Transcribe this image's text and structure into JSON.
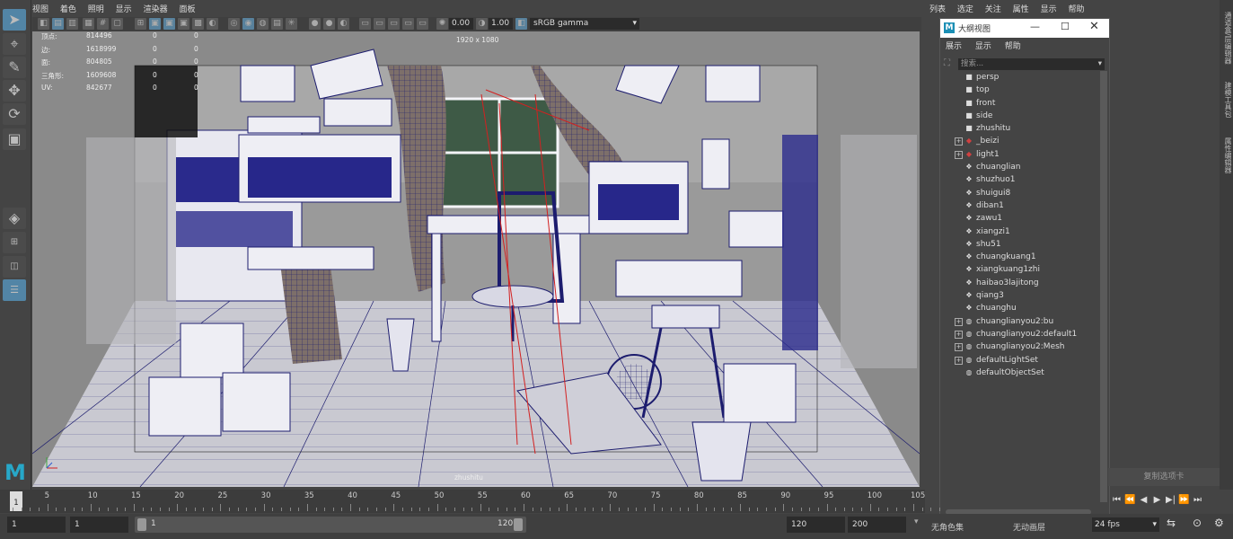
{
  "viewport_menu": [
    "视图",
    "着色",
    "照明",
    "显示",
    "渲染器",
    "面板"
  ],
  "viewport_toolbar": {
    "exposure": "0.00",
    "gamma_value": "1.00",
    "color_space": "sRGB gamma"
  },
  "hud": {
    "rows": [
      {
        "label": "顶点:",
        "a": "814496",
        "b": "0",
        "c": "0"
      },
      {
        "label": "边:",
        "a": "1618999",
        "b": "0",
        "c": "0"
      },
      {
        "label": "面:",
        "a": "804805",
        "b": "0",
        "c": "0"
      },
      {
        "label": "三角形:",
        "a": "1609608",
        "b": "0",
        "c": "0"
      },
      {
        "label": "UV:",
        "a": "842677",
        "b": "0",
        "c": "0"
      }
    ],
    "resolution": "1920 x 1080",
    "camera": "zhushitu"
  },
  "right_menu": [
    "列表",
    "选定",
    "关注",
    "属性",
    "显示",
    "帮助"
  ],
  "outliner": {
    "title": "大纲视图",
    "menu": [
      "展示",
      "显示",
      "帮助"
    ],
    "search_placeholder": "搜索...",
    "items": [
      {
        "label": "persp",
        "icon": "camera-icon",
        "expand": ""
      },
      {
        "label": "top",
        "icon": "camera-icon",
        "expand": ""
      },
      {
        "label": "front",
        "icon": "camera-icon",
        "expand": ""
      },
      {
        "label": "side",
        "icon": "camera-icon",
        "expand": ""
      },
      {
        "label": "zhushitu",
        "icon": "camera-icon",
        "expand": ""
      },
      {
        "label": "_beizi",
        "icon": "light-icon",
        "expand": "+"
      },
      {
        "label": "light1",
        "icon": "light-icon",
        "expand": "+"
      },
      {
        "label": "chuanglian",
        "icon": "mesh-icon",
        "expand": ""
      },
      {
        "label": "shuzhuo1",
        "icon": "mesh-icon",
        "expand": ""
      },
      {
        "label": "shuigui8",
        "icon": "mesh-icon",
        "expand": ""
      },
      {
        "label": "diban1",
        "icon": "mesh-icon",
        "expand": ""
      },
      {
        "label": "zawu1",
        "icon": "mesh-icon",
        "expand": ""
      },
      {
        "label": "xiangzi1",
        "icon": "mesh-icon",
        "expand": ""
      },
      {
        "label": "shu51",
        "icon": "mesh-icon",
        "expand": ""
      },
      {
        "label": "chuangkuang1",
        "icon": "mesh-icon",
        "expand": ""
      },
      {
        "label": "xiangkuang1zhi",
        "icon": "mesh-icon",
        "expand": ""
      },
      {
        "label": "haibao3lajitong",
        "icon": "mesh-icon",
        "expand": ""
      },
      {
        "label": "qiang3",
        "icon": "mesh-icon",
        "expand": ""
      },
      {
        "label": "chuanghu",
        "icon": "mesh-icon",
        "expand": ""
      },
      {
        "label": "chuanglianyou2:bu",
        "icon": "set-icon",
        "expand": "+"
      },
      {
        "label": "chuanglianyou2:default1",
        "icon": "set-icon",
        "expand": "+"
      },
      {
        "label": "chuanglianyou2:Mesh",
        "icon": "set-icon",
        "expand": "+"
      },
      {
        "label": "defaultLightSet",
        "icon": "set-icon",
        "expand": "+"
      },
      {
        "label": "defaultObjectSet",
        "icon": "set-icon",
        "expand": ""
      }
    ]
  },
  "side_tabs": [
    "通道盒/层编辑器",
    "建模工具包",
    "属性编辑器"
  ],
  "copy_tab": "复制选项卡",
  "timeline": {
    "current_frame": "1",
    "ticks": [
      "5",
      "10",
      "15",
      "20",
      "25",
      "30",
      "35",
      "40",
      "45",
      "50",
      "55",
      "60",
      "65",
      "70",
      "75",
      "80",
      "85",
      "90",
      "95",
      "100",
      "105"
    ]
  },
  "range": {
    "start": "1",
    "playback_start": "1",
    "slider_start": "1",
    "slider_end": "120",
    "playback_end": "120",
    "end": "200",
    "character_set": "无角色集",
    "anim_layer": "无动画层",
    "fps": "24 fps"
  },
  "colors": {
    "accent": "#5285a6",
    "viewport_bg": "#858585",
    "wire": "#1c1c6e",
    "maya_logo": "#27a8c9"
  }
}
